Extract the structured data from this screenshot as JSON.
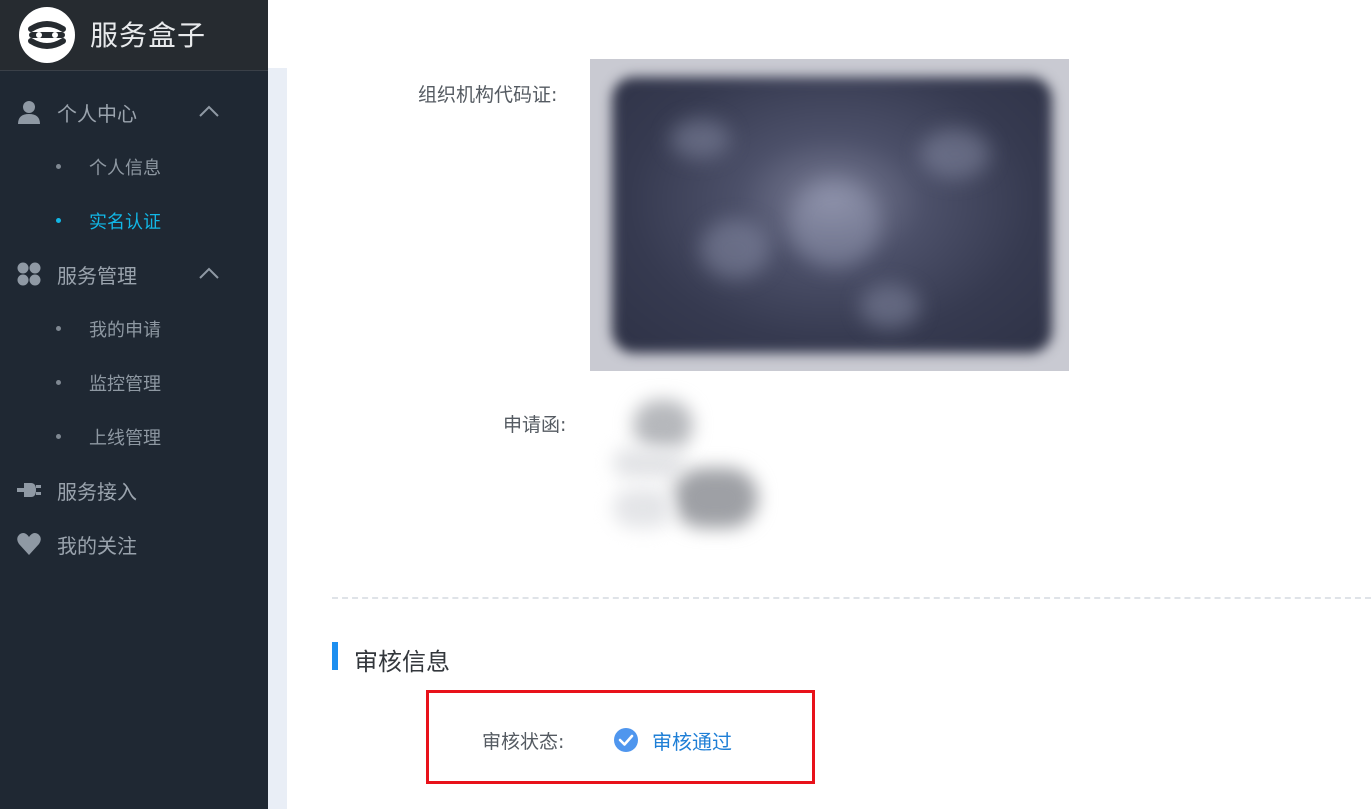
{
  "app": {
    "title": "服务盒子"
  },
  "sidebar": {
    "groups": [
      {
        "label": "个人中心",
        "icon": "user-icon",
        "expanded": true,
        "items": [
          {
            "label": "个人信息",
            "active": false
          },
          {
            "label": "实名认证",
            "active": true
          }
        ]
      },
      {
        "label": "服务管理",
        "icon": "grid-icon",
        "expanded": true,
        "items": [
          {
            "label": "我的申请",
            "active": false
          },
          {
            "label": "监控管理",
            "active": false
          },
          {
            "label": "上线管理",
            "active": false
          }
        ]
      },
      {
        "label": "服务接入",
        "icon": "plug-icon"
      },
      {
        "label": "我的关注",
        "icon": "heart-icon"
      }
    ]
  },
  "main": {
    "org_code_label": "组织机构代码证:",
    "application_letter_label": "申请函:",
    "review_section_title": "审核信息",
    "review_status_label": "审核状态:",
    "review_status_value": "审核通过"
  },
  "colors": {
    "sidebar_bg": "#1f2833",
    "accent": "#12b7e6",
    "status_blue": "#1f7fd6",
    "section_bar": "#1d8ff0",
    "highlight_red": "#e8121a"
  }
}
